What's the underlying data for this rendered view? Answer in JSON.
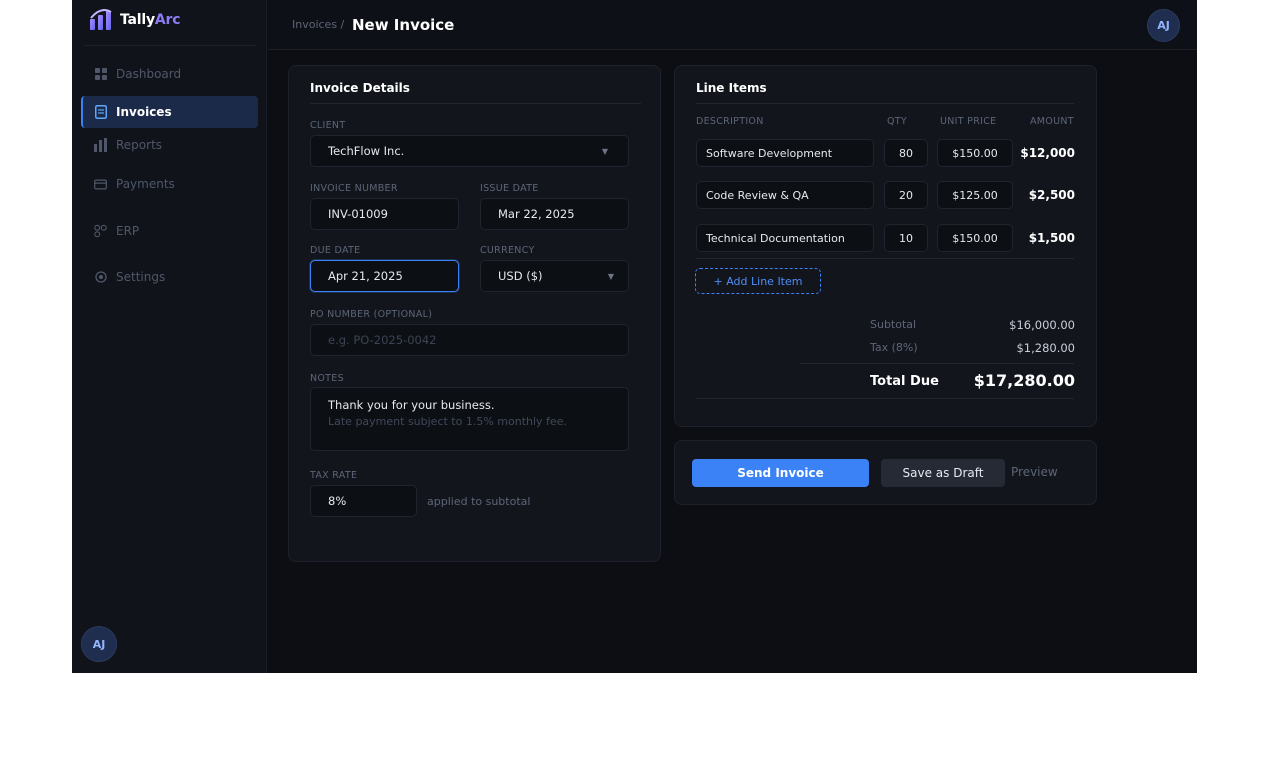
{
  "app": {
    "name_prefix": "Tally",
    "name_accent": "Arc",
    "brand_color": "#8b7cf6",
    "accent_color": "#3b82f6",
    "user_initials": "AJ"
  },
  "sidebar": {
    "items": [
      {
        "label": "Dashboard",
        "icon": "grid-icon",
        "active": false
      },
      {
        "label": "Invoices",
        "icon": "document-icon",
        "active": true
      },
      {
        "label": "Reports",
        "icon": "bar-chart-icon",
        "active": false
      },
      {
        "label": "Payments",
        "icon": "credit-card-icon",
        "active": false
      },
      {
        "label": "ERP",
        "icon": "nodes-icon",
        "active": false
      },
      {
        "label": "Settings",
        "icon": "gear-icon",
        "active": false
      }
    ]
  },
  "header": {
    "breadcrumb": "Invoices /",
    "title": "New Invoice"
  },
  "details": {
    "title": "Invoice Details",
    "client_label": "CLIENT",
    "client_value": "TechFlow Inc.",
    "invoice_number_label": "INVOICE NUMBER",
    "invoice_number_value": "INV-01009",
    "issue_date_label": "ISSUE DATE",
    "issue_date_value": "Mar 22, 2025",
    "due_date_label": "DUE DATE",
    "due_date_value": "Apr 21, 2025",
    "currency_label": "CURRENCY",
    "currency_value": "USD ($)",
    "po_label": "PO NUMBER (OPTIONAL)",
    "po_placeholder": "e.g. PO-2025-0042",
    "notes_label": "NOTES",
    "notes_line1": "Thank you for your business.",
    "notes_line2": "Late payment subject to 1.5% monthly fee.",
    "tax_label": "TAX RATE",
    "tax_value": "8%",
    "tax_hint": "applied to subtotal"
  },
  "line_items": {
    "title": "Line Items",
    "columns": {
      "description": "DESCRIPTION",
      "qty": "QTY",
      "unit_price": "UNIT PRICE",
      "amount": "AMOUNT"
    },
    "rows": [
      {
        "description": "Software Development",
        "qty": "80",
        "unit_price": "$150.00",
        "amount": "$12,000"
      },
      {
        "description": "Code Review & QA",
        "qty": "20",
        "unit_price": "$125.00",
        "amount": "$2,500"
      },
      {
        "description": "Technical Documentation",
        "qty": "10",
        "unit_price": "$150.00",
        "amount": "$1,500"
      }
    ],
    "add_label": "+ Add Line Item",
    "subtotal_label": "Subtotal",
    "subtotal_value": "$16,000.00",
    "tax_label": "Tax (8%)",
    "tax_value": "$1,280.00",
    "total_label": "Total Due",
    "total_value": "$17,280.00"
  },
  "actions": {
    "send": "Send Invoice",
    "draft": "Save as Draft",
    "preview": "Preview"
  }
}
